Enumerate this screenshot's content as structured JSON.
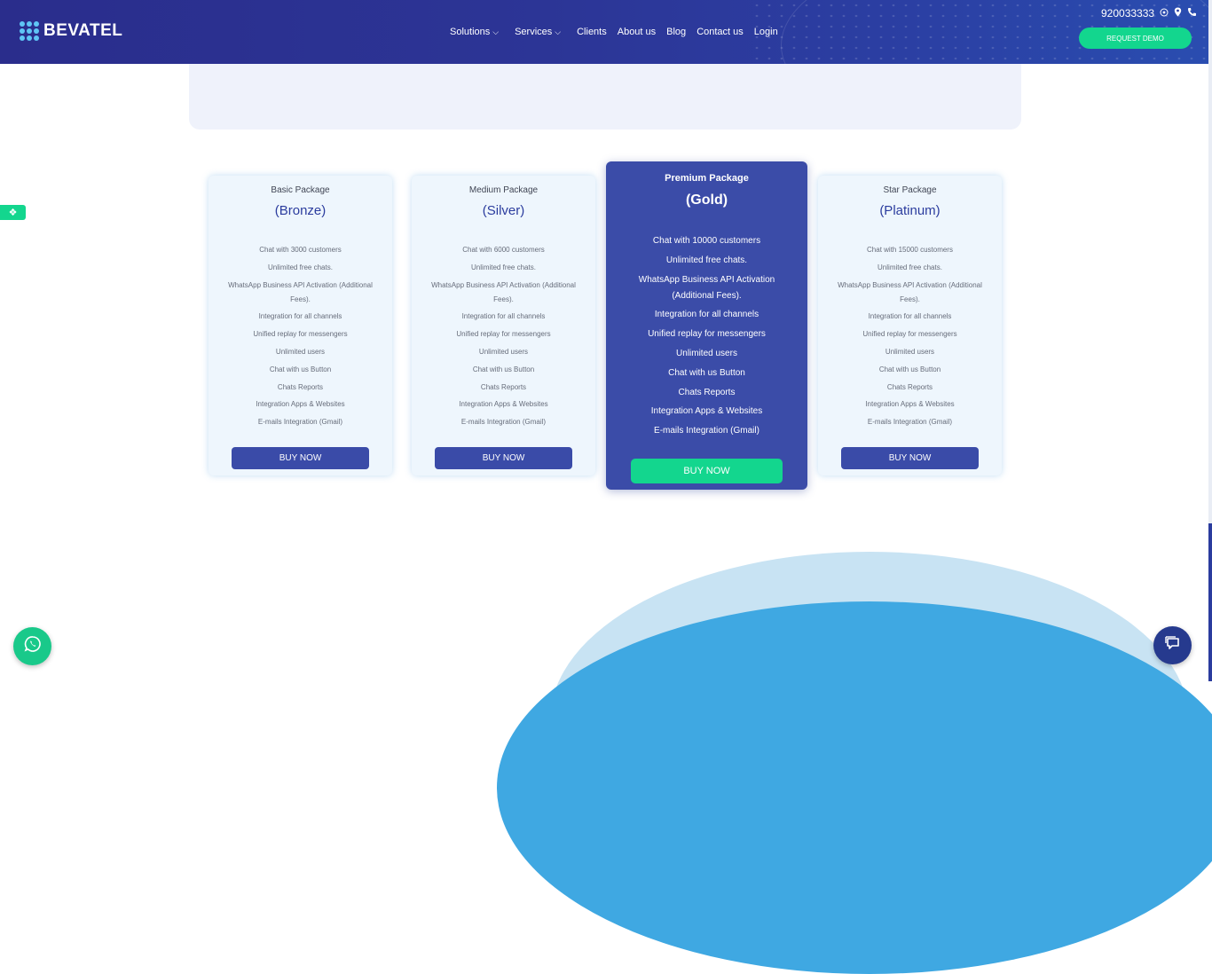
{
  "header": {
    "logo_text": "BEVATEL",
    "nav": [
      {
        "label": "Solutions",
        "dropdown": true
      },
      {
        "label": "Services",
        "dropdown": true
      },
      {
        "label": "Clients"
      },
      {
        "label": "About us"
      },
      {
        "label": "Blog"
      },
      {
        "label": "Contact us"
      },
      {
        "label": "Login"
      }
    ],
    "phone": "920033333",
    "contact_icons": [
      "whatsapp-icon",
      "location-pin-icon",
      "phone-icon"
    ],
    "request_demo": "REQUEST DEMO"
  },
  "colors": {
    "header_bg": "#2c3596",
    "accent_green": "#13d68e",
    "primary_blue": "#3a4ba8",
    "card_bg": "#eef6fd"
  },
  "plans": [
    {
      "package": "Basic Package",
      "tier": "(Bronze)",
      "features": [
        "Chat with 3000 customers",
        "Unlimited free chats.",
        "WhatsApp Business API Activation (Additional Fees).",
        "Integration for all channels",
        "Unified replay for messengers",
        "Unlimited users",
        "Chat with us Button",
        "Chats Reports",
        "Integration Apps & Websites",
        "E-mails Integration (Gmail)"
      ],
      "cta": "BUY NOW"
    },
    {
      "package": "Medium Package",
      "tier": "(Silver)",
      "features": [
        "Chat with 6000 customers",
        "Unlimited free chats.",
        "WhatsApp Business API Activation (Additional Fees).",
        "Integration for all channels",
        "Unified replay for messengers",
        "Unlimited users",
        "Chat with us Button",
        "Chats Reports",
        "Integration Apps & Websites",
        "E-mails Integration (Gmail)"
      ],
      "cta": "BUY NOW"
    },
    {
      "package": "Premium Package",
      "tier": "(Gold)",
      "featured": true,
      "features": [
        "Chat with 10000 customers",
        "Unlimited free chats.",
        "WhatsApp Business API Activation (Additional Fees).",
        "Integration for all channels",
        "Unified replay for messengers",
        "Unlimited users",
        "Chat with us Button",
        "Chats Reports",
        "Integration Apps & Websites",
        "E-mails Integration (Gmail)"
      ],
      "cta": "BUY NOW"
    },
    {
      "package": "Star Package",
      "tier": "(Platinum)",
      "features": [
        "Chat with 15000 customers",
        "Unlimited free chats.",
        "WhatsApp Business API Activation (Additional Fees).",
        "Integration for all channels",
        "Unified replay for messengers",
        "Unlimited users",
        "Chat with us Button",
        "Chats Reports",
        "Integration Apps & Websites",
        "E-mails Integration (Gmail)"
      ],
      "cta": "BUY NOW"
    }
  ],
  "floating": {
    "side_tab_icon": "accessibility-icon",
    "whatsapp_icon": "whatsapp-icon",
    "chat_icon": "chat-bubble-icon"
  }
}
